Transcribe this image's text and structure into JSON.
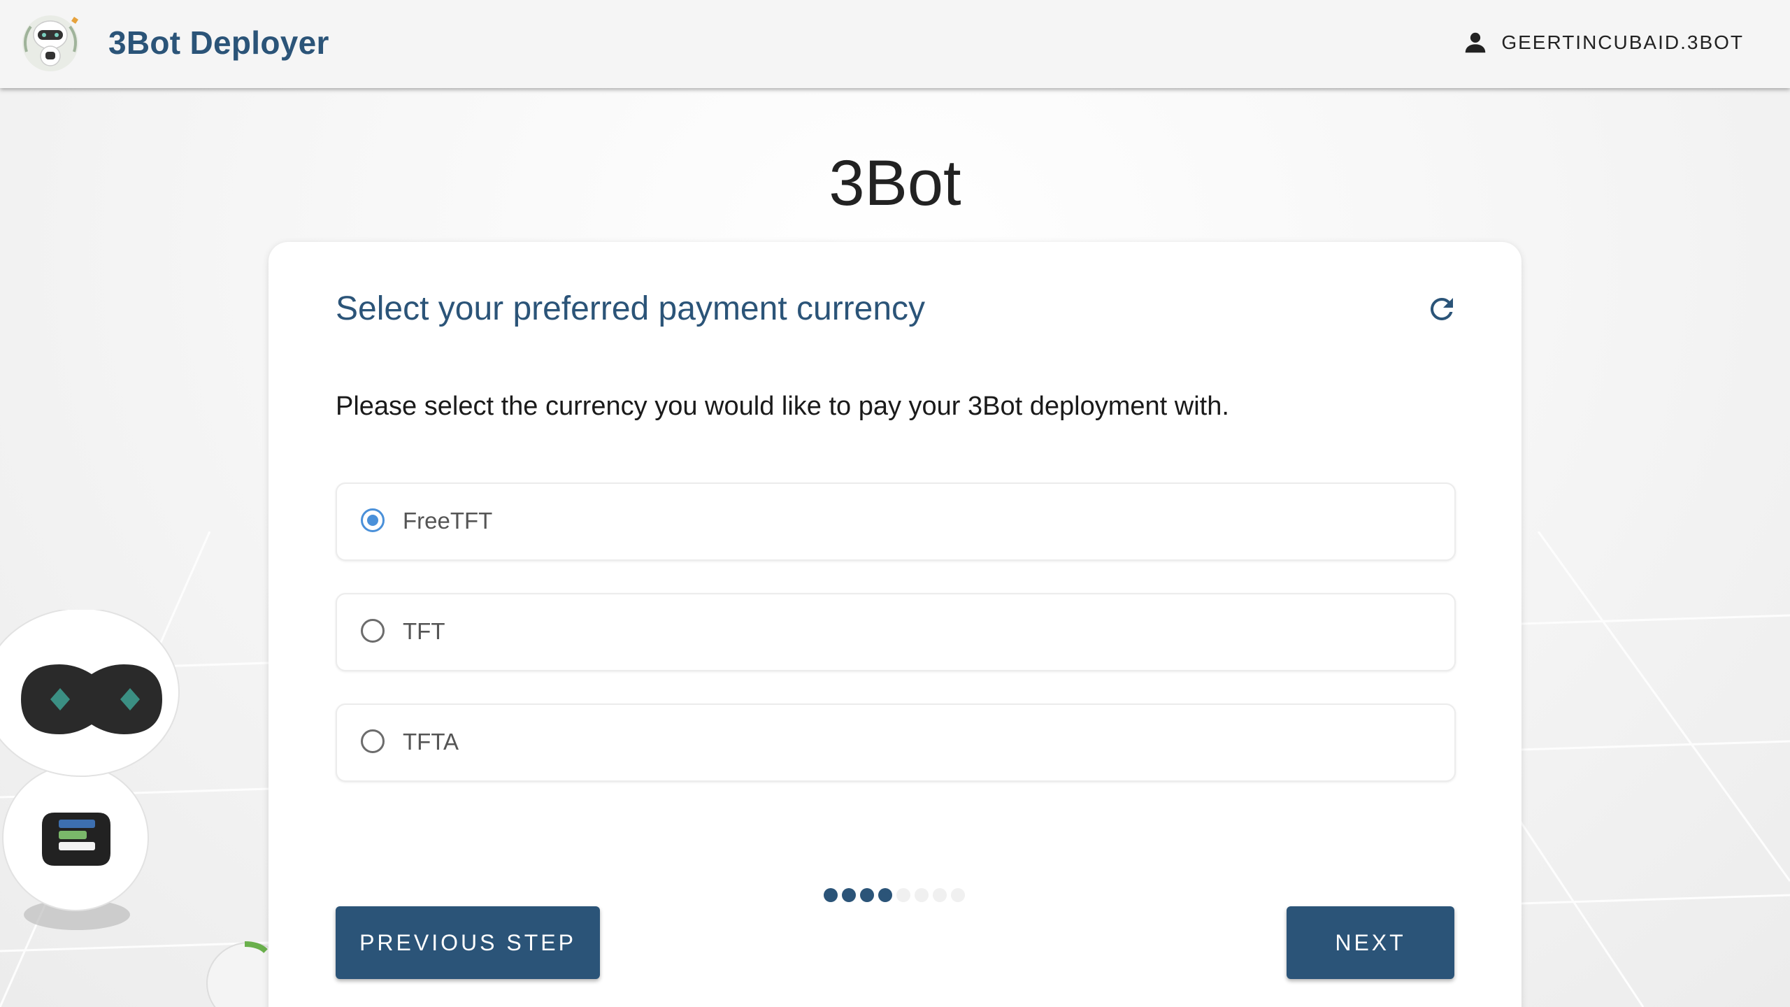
{
  "header": {
    "brand": "3Bot Deployer",
    "username": "GEERTINCUBAID.3BOT"
  },
  "page": {
    "title": "3Bot"
  },
  "card": {
    "title": "Select your preferred payment currency",
    "instruction": "Please select the currency you would like to pay your 3Bot deployment with.",
    "options": [
      {
        "label": "FreeTFT",
        "selected": true
      },
      {
        "label": "TFT",
        "selected": false
      },
      {
        "label": "TFTA",
        "selected": false
      }
    ],
    "steps": {
      "total": 8,
      "current": 4
    },
    "previous_label": "PREVIOUS STEP",
    "next_label": "NEXT"
  },
  "colors": {
    "brand": "#2b5478",
    "radio_selected": "#4a90d9"
  },
  "icons": {
    "user": "account-icon",
    "refresh": "refresh-icon",
    "logo": "robot-logo-icon"
  }
}
